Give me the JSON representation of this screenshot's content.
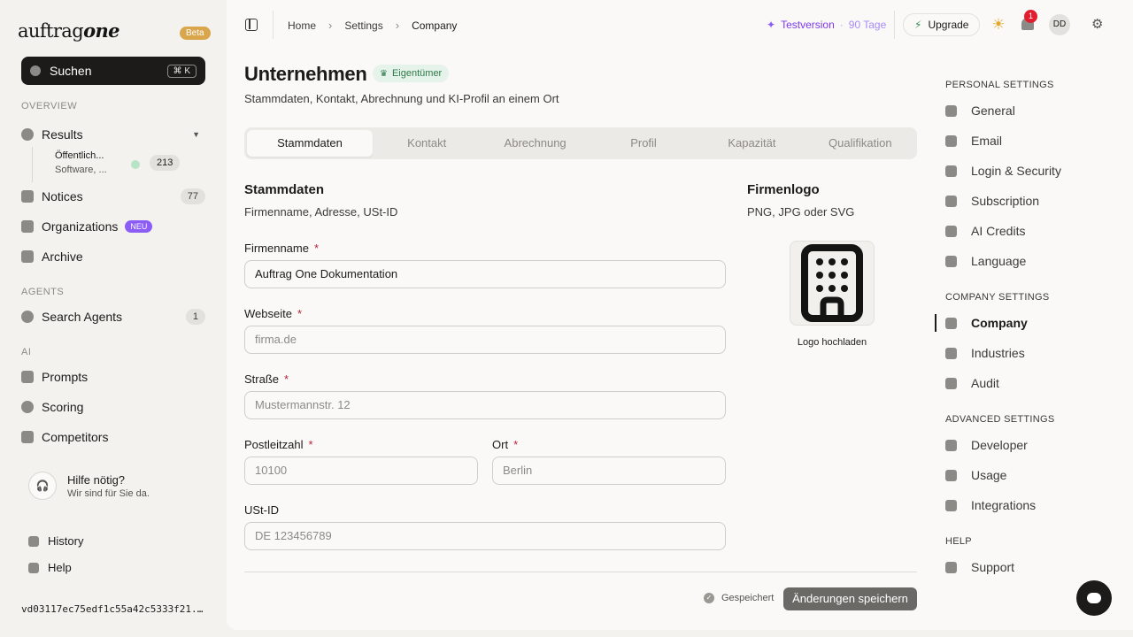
{
  "brand": {
    "logo_light": "auftrag",
    "logo_bold": "one",
    "beta_label": "Beta"
  },
  "search": {
    "label": "Suchen",
    "shortcut": "⌘ K"
  },
  "sidebar": {
    "overview_label": "OVERVIEW",
    "results": {
      "label": "Results"
    },
    "results_sub": {
      "title": "Öffentlich...",
      "subtitle": "Software, ...",
      "count": "213"
    },
    "notices": {
      "label": "Notices",
      "count": "77"
    },
    "organizations": {
      "label": "Organizations",
      "badge": "NEU"
    },
    "archive": {
      "label": "Archive"
    },
    "agents_label": "AGENTS",
    "search_agents": {
      "label": "Search Agents",
      "count": "1"
    },
    "ai_label": "AI",
    "prompts": {
      "label": "Prompts"
    },
    "scoring": {
      "label": "Scoring"
    },
    "competitors": {
      "label": "Competitors"
    },
    "help_box": {
      "title": "Hilfe nötig?",
      "subtitle": "Wir sind für Sie da."
    },
    "history": {
      "label": "History"
    },
    "help": {
      "label": "Help"
    },
    "version": "vd03117ec75edf1c55a42c5333f21..."
  },
  "topbar": {
    "breadcrumbs": [
      "Home",
      "Settings",
      "Company"
    ],
    "trial_label": "Testversion",
    "trial_days": "90 Tage",
    "upgrade_label": "Upgrade",
    "notification_count": "1",
    "avatar_initials": "DD"
  },
  "page": {
    "title": "Unternehmen",
    "owner_badge": "Eigentümer",
    "subtitle": "Stammdaten, Kontakt, Abrechnung und KI-Profil an einem Ort"
  },
  "tabs": [
    "Stammdaten",
    "Kontakt",
    "Abrechnung",
    "Profil",
    "Kapazität",
    "Qualifikation"
  ],
  "form": {
    "section_title": "Stammdaten",
    "section_subtitle": "Firmenname, Adresse, USt-ID",
    "company_name": {
      "label": "Firmenname",
      "value": "Auftrag One Dokumentation"
    },
    "website": {
      "label": "Webseite",
      "placeholder": "firma.de"
    },
    "street": {
      "label": "Straße",
      "placeholder": "Mustermannstr. 12"
    },
    "postal": {
      "label": "Postleitzahl",
      "placeholder": "10100"
    },
    "city": {
      "label": "Ort",
      "placeholder": "Berlin"
    },
    "vat": {
      "label": "USt-ID",
      "placeholder": "DE 123456789"
    },
    "required_mark": "*"
  },
  "logo_panel": {
    "title": "Firmenlogo",
    "subtitle": "PNG, JPG oder SVG",
    "upload_label": "Logo hochladen"
  },
  "footer": {
    "saved_label": "Gespeichert",
    "save_button": "Änderungen speichern"
  },
  "settings_nav": {
    "personal_label": "PERSONAL SETTINGS",
    "general": "General",
    "email": "Email",
    "login_security": "Login & Security",
    "subscription": "Subscription",
    "ai_credits": "AI Credits",
    "language": "Language",
    "company_label": "COMPANY SETTINGS",
    "company": "Company",
    "industries": "Industries",
    "audit": "Audit",
    "advanced_label": "ADVANCED SETTINGS",
    "developer": "Developer",
    "usage": "Usage",
    "integrations": "Integrations",
    "help_label": "HELP",
    "support": "Support"
  },
  "colors": {
    "accent_purple": "#8b5cf6",
    "beta": "#d9a64c",
    "required": "#b4233b",
    "owner_green": "#2f7a4a"
  }
}
